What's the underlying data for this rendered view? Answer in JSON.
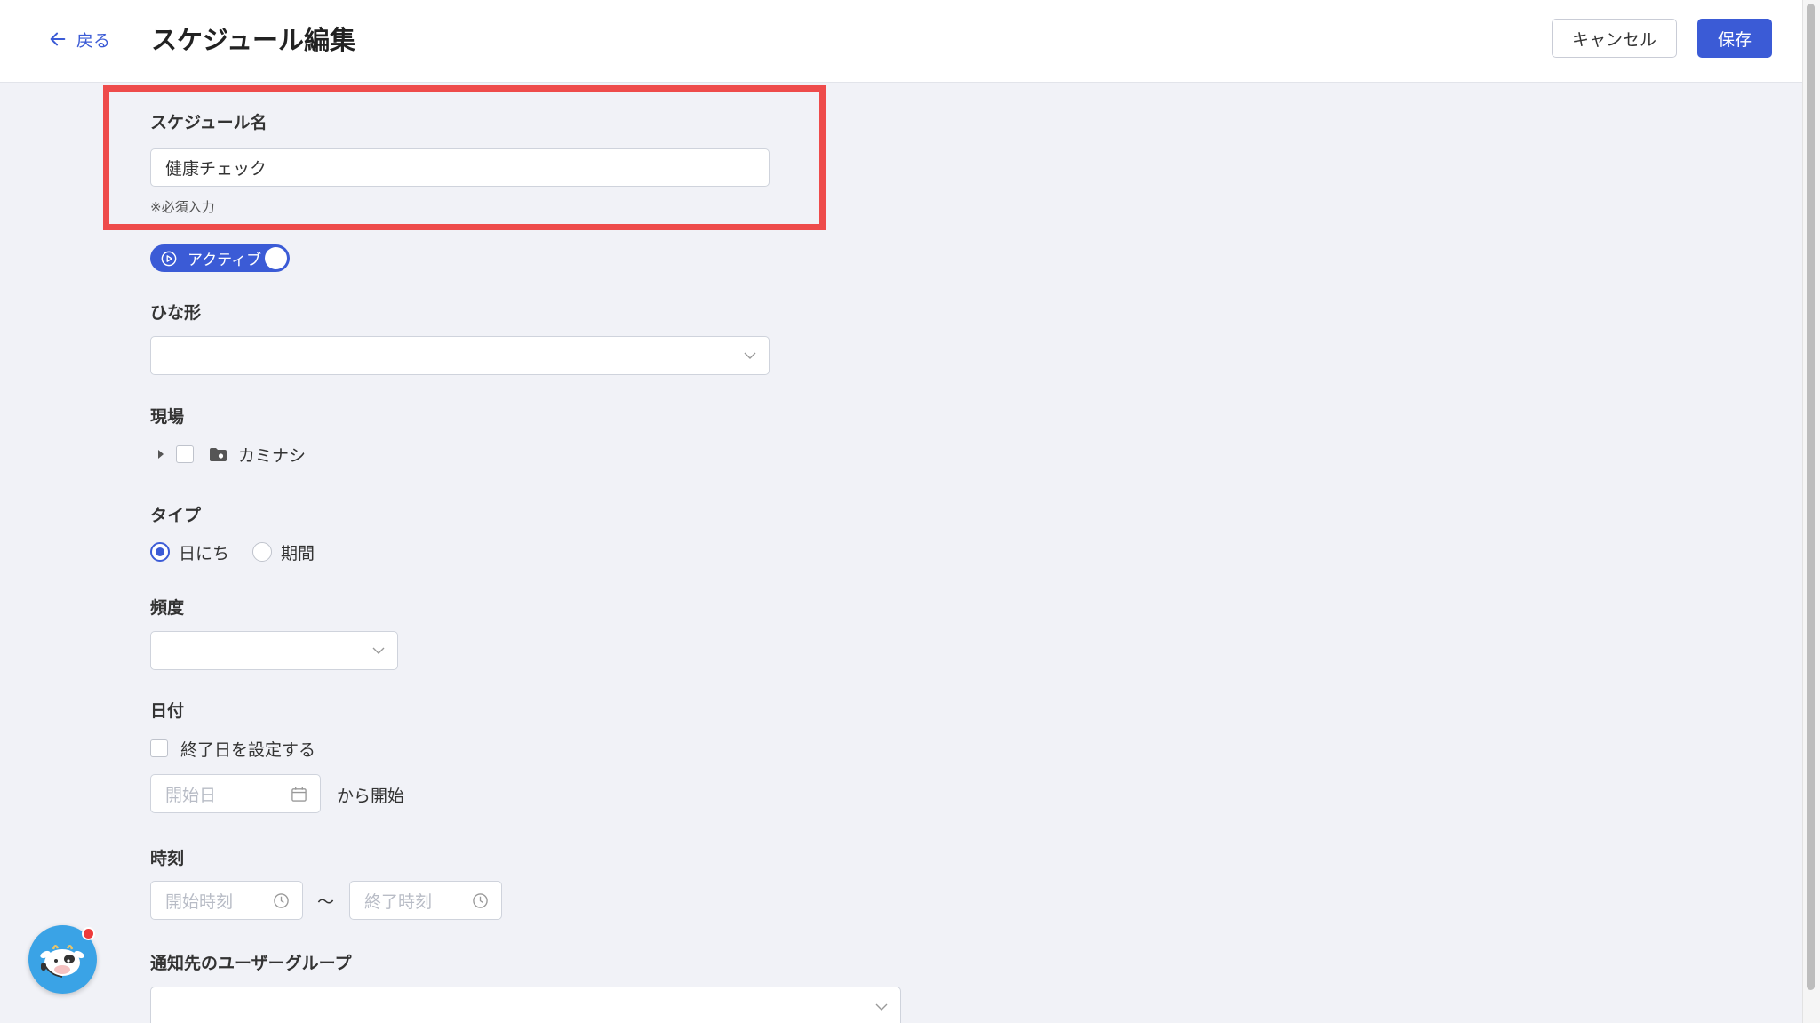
{
  "header": {
    "back_label": "戻る",
    "title": "スケジュール編集",
    "cancel_label": "キャンセル",
    "save_label": "保存"
  },
  "form": {
    "schedule_name": {
      "label": "スケジュール名",
      "value": "健康チェック",
      "required_note": "※必須入力"
    },
    "active_toggle": {
      "label": "アクティブ",
      "state": "on"
    },
    "template": {
      "label": "ひな形",
      "value": ""
    },
    "site": {
      "label": "現場",
      "tree_item": "カミナシ"
    },
    "type": {
      "label": "タイプ",
      "options": [
        "日にち",
        "期間"
      ],
      "selected": "日にち"
    },
    "frequency": {
      "label": "頻度",
      "value": ""
    },
    "date": {
      "label": "日付",
      "end_date_checkbox": "終了日を設定する",
      "start_placeholder": "開始日",
      "start_suffix": "から開始"
    },
    "time": {
      "label": "時刻",
      "start_placeholder": "開始時刻",
      "separator": "〜",
      "end_placeholder": "終了時刻"
    },
    "notify_group": {
      "label": "通知先のユーザーグループ",
      "value": ""
    }
  },
  "colors": {
    "accent": "#3b5bd6",
    "highlight": "#ee4b4b",
    "background": "#f1f2f7"
  }
}
